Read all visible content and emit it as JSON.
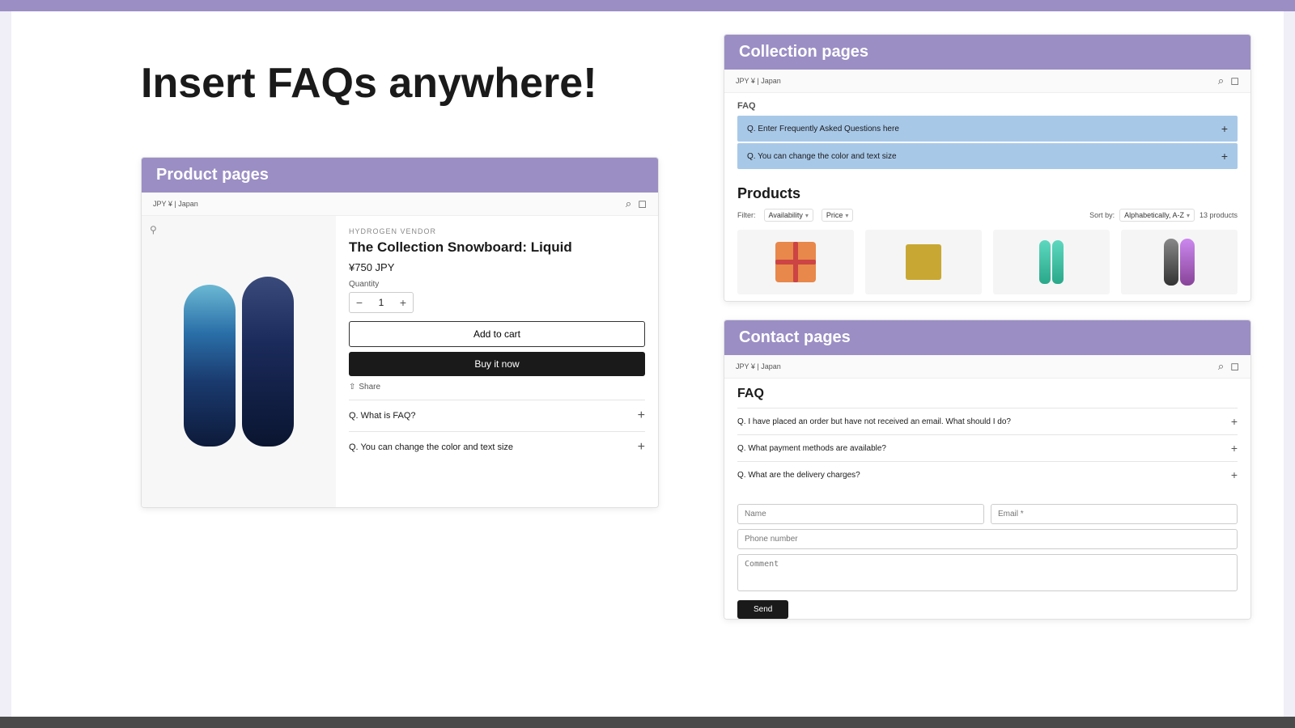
{
  "page": {
    "bg_top_color": "#9b8ec4",
    "bg_bottom_color": "#4a4a4a",
    "hero_title": "Insert FAQs anywhere!"
  },
  "product_card": {
    "section_label": "Product pages",
    "locale": "JPY ¥ | Japan",
    "vendor": "HYDROGEN VENDOR",
    "product_name": "The Collection Snowboard: Liquid",
    "price": "¥750 JPY",
    "qty_label": "Quantity",
    "qty_value": "1",
    "add_to_cart": "Add to cart",
    "buy_now": "Buy it now",
    "share_label": "Share",
    "faq_items": [
      {
        "question": "Q. What is FAQ?",
        "expanded": false
      },
      {
        "question": "Q. You can change the color and text size",
        "expanded": false
      }
    ]
  },
  "collection_card": {
    "section_label": "Collection pages",
    "locale": "JPY ¥ | Japan",
    "faq_label": "FAQ",
    "faq_items": [
      {
        "question": "Q. Enter Frequently Asked Questions here"
      },
      {
        "question": "Q. You can change the color and text size"
      }
    ],
    "products_title": "Products",
    "filter_label": "Filter:",
    "availability_filter": "Availability",
    "price_filter": "Price",
    "sort_label": "Sort by:",
    "sort_value": "Alphabetically, A-Z",
    "products_count": "13 products"
  },
  "contact_card": {
    "section_label": "Contact pages",
    "locale": "JPY ¥ | Japan",
    "faq_title": "FAQ",
    "faq_items": [
      {
        "question": "Q. I have placed an order but have not received an email. What should I do?"
      },
      {
        "question": "Q. What payment methods are available?"
      },
      {
        "question": "Q. What are the delivery charges?"
      }
    ],
    "form": {
      "name_placeholder": "Name",
      "email_placeholder": "Email *",
      "phone_placeholder": "Phone number",
      "comment_placeholder": "Comment",
      "submit_label": "Send"
    }
  }
}
